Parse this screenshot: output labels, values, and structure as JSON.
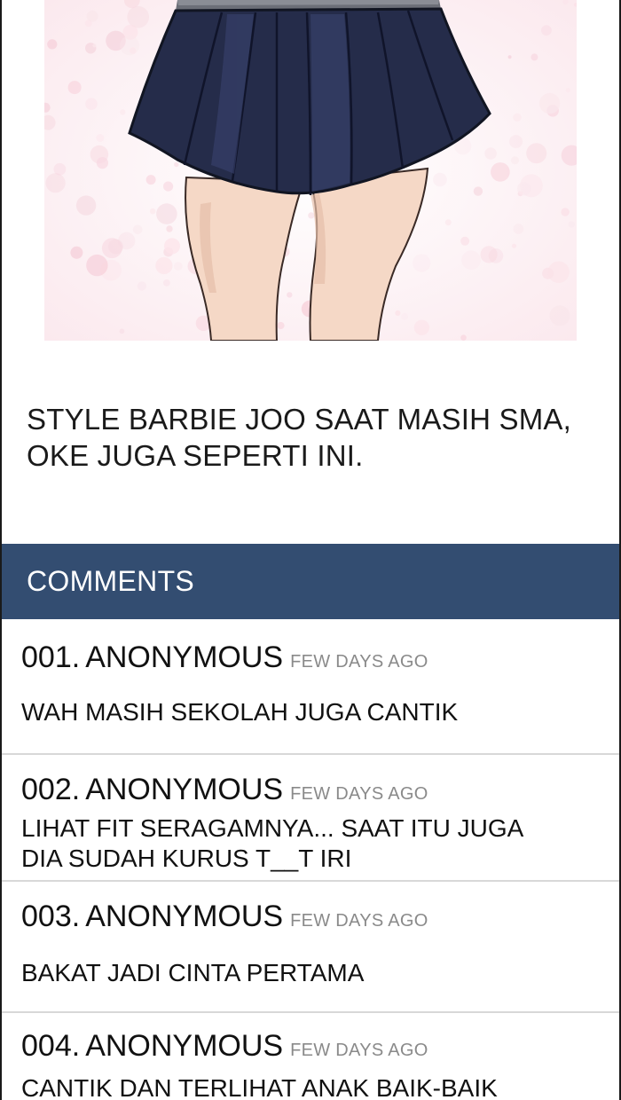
{
  "caption": {
    "lines": [
      "STYLE BARBIE JOO SAAT MASIH SMA,",
      "OKE JUGA SEPERTI INI."
    ]
  },
  "comments_section": {
    "title": "COMMENTS",
    "header_color": "#334d71",
    "items": [
      {
        "number": "001.",
        "author": "ANONYMOUS",
        "time": "FEW DAYS AGO",
        "lines": [
          "WAH MASIH SEKOLAH JUGA CANTIK"
        ]
      },
      {
        "number": "002.",
        "author": "ANONYMOUS",
        "time": "FEW DAYS AGO",
        "lines": [
          "LIHAT FIT SERAGAMNYA... SAAT ITU JUGA",
          "DIA SUDAH KURUS T__T IRI"
        ]
      },
      {
        "number": "003.",
        "author": "ANONYMOUS",
        "time": "FEW DAYS AGO",
        "lines": [
          "BAKAT JADI CINTA PERTAMA"
        ]
      },
      {
        "number": "004.",
        "author": "ANONYMOUS",
        "time": "FEW DAYS AGO",
        "lines": [
          "CANTIK DAN TERLIHAT ANAK BAIK-BAIK"
        ]
      }
    ]
  },
  "illustration": {
    "skirt_color": "#252c4a",
    "skin_color": "#f5d8c6",
    "background_color": "#fbeef2"
  }
}
